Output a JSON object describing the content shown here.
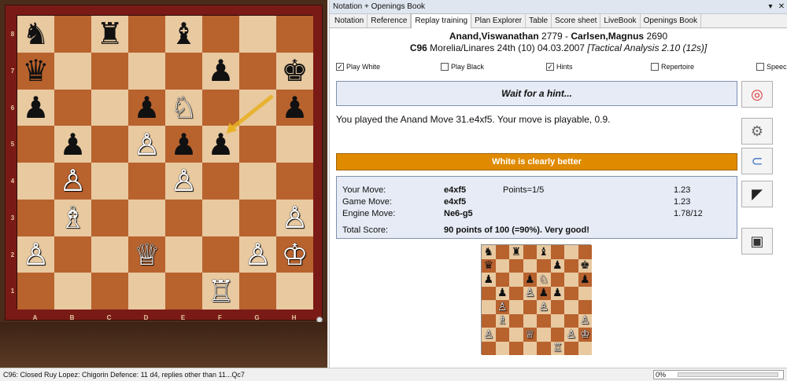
{
  "board": {
    "files": [
      "A",
      "B",
      "C",
      "D",
      "E",
      "F",
      "G",
      "H"
    ],
    "ranks": [
      "8",
      "7",
      "6",
      "5",
      "4",
      "3",
      "2",
      "1"
    ],
    "position": [
      [
        "bn",
        "",
        "br",
        "",
        "bb",
        "",
        "",
        ""
      ],
      [
        "bq",
        "",
        "",
        "",
        "",
        "bp",
        "",
        "bk"
      ],
      [
        "bp",
        "",
        "",
        "bp",
        "wn",
        "",
        "",
        "bp"
      ],
      [
        "",
        "bp",
        "",
        "wp",
        "bp",
        "bp",
        "",
        ""
      ],
      [
        "",
        "wp",
        "",
        "",
        "wp",
        "",
        "",
        ""
      ],
      [
        "",
        "wb",
        "",
        "",
        "",
        "",
        "",
        "wp"
      ],
      [
        "wp",
        "",
        "",
        "wq",
        "",
        "",
        "wp",
        "wk"
      ],
      [
        "",
        "",
        "",
        "",
        "",
        "wr",
        "",
        ""
      ]
    ],
    "arrow": {
      "from": "g6",
      "to": "f5",
      "color": "#e8b020"
    }
  },
  "pieces": {
    "wk": "♔",
    "wq": "♕",
    "wr": "♖",
    "wb": "♗",
    "wn": "♘",
    "wp": "♙",
    "bk": "♚",
    "bq": "♛",
    "br": "♜",
    "bb": "♝",
    "bn": "♞",
    "bp": "♟"
  },
  "window": {
    "title": "Notation + Openings Book",
    "pin_icon": "pin-icon",
    "close_icon": "close-icon"
  },
  "tabs": [
    "Notation",
    "Reference",
    "Replay training",
    "Plan Explorer",
    "Table",
    "Score sheet",
    "LiveBook",
    "Openings Book"
  ],
  "active_tab": 2,
  "game": {
    "white": "Anand,Viswanathan",
    "white_elo": "2779",
    "black": "Carlsen,Magnus",
    "black_elo": "2690",
    "eco": "C96",
    "event_line": "Morelia/Linares 24th (10) 04.03.2007",
    "analysis": "[Tactical Analysis 2.10 (12s)]"
  },
  "options": [
    {
      "label": "Play White",
      "checked": true
    },
    {
      "label": "Play Black",
      "checked": false
    },
    {
      "label": "Hints",
      "checked": true
    },
    {
      "label": "Repertoire",
      "checked": false
    },
    {
      "label": "Speech",
      "checked": false
    }
  ],
  "hint_label": "Wait for a hint...",
  "played_message": "You played the Anand Move 31.e4xf5. Your move is playable, 0.9.",
  "evaluation": "White is clearly better",
  "score": {
    "your_move_label": "Your Move:",
    "your_move": "e4xf5",
    "points": "Points=1/5",
    "your_eval": "1.23",
    "game_move_label": "Game Move:",
    "game_move": "e4xf5",
    "game_eval": "1.23",
    "engine_move_label": "Engine Move:",
    "engine_move": "Ne6-g5",
    "engine_eval": "1.78/12",
    "total_label": "Total Score:",
    "total": "90 points of 100 (=90%). Very good!"
  },
  "side_buttons": [
    "lifebuoy-icon",
    "gears-icon",
    "magnet-icon",
    "satellite-icon",
    "save-icon"
  ],
  "status": {
    "opening": "C96: Closed Ruy Lopez: Chigorin Defence: 11 d4, replies other than 11...Qc7",
    "progress": "0%"
  }
}
